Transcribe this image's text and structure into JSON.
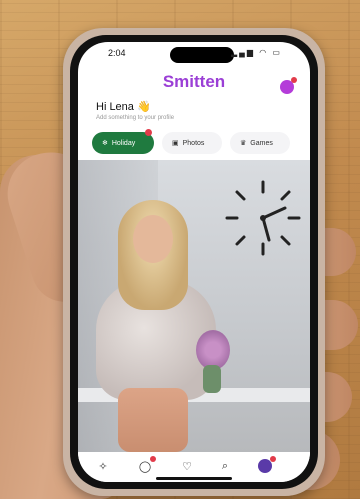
{
  "status": {
    "time": "2:04",
    "icons": "▂▄▆ ◠ ▭"
  },
  "app": {
    "title": "Smitten"
  },
  "greeting": {
    "text": "Hi Lena 👋",
    "subtitle": "Add something to your profile"
  },
  "chips": [
    {
      "label": "Holiday",
      "icon": "snowflake-icon",
      "active": true
    },
    {
      "label": "Photos",
      "icon": "camera-icon",
      "active": false
    },
    {
      "label": "Games",
      "icon": "crown-icon",
      "active": false
    }
  ],
  "nav": [
    {
      "icon": "sparkle-icon"
    },
    {
      "icon": "chat-icon"
    },
    {
      "icon": "hearts-icon"
    },
    {
      "icon": "search-icon"
    },
    {
      "icon": "profile-avatar"
    }
  ],
  "colors": {
    "brand": "#9b3fd6",
    "active_chip": "#1f7a3f",
    "badge": "#e23b4a"
  }
}
